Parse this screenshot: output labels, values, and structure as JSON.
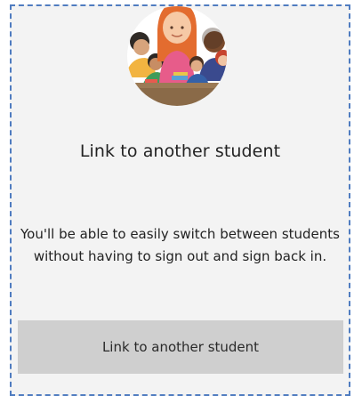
{
  "panel": {
    "illustration_icon": "students-group-illustration",
    "title": "Link to another student",
    "description": "You'll be able to easily switch between students without having to sign out and sign back in.",
    "button_label": "Link to another student"
  },
  "colors": {
    "panel_background": "#f3f3f3",
    "dashed_border": "#4f7cc0",
    "button_background": "#cfcfcf",
    "text": "#222222"
  }
}
